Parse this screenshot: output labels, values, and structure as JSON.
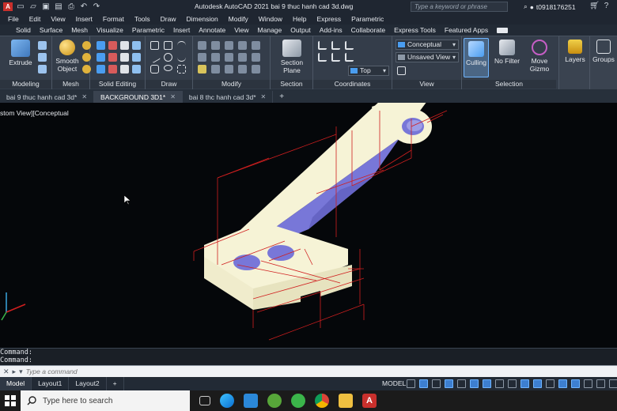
{
  "app": {
    "title": "Autodesk AutoCAD 2021    bai 9 thuc hanh cad 3d.dwg",
    "search_placeholder": "Type a keyword or phrase",
    "user": "t0918176251"
  },
  "menu": [
    "File",
    "Edit",
    "View",
    "Insert",
    "Format",
    "Tools",
    "Draw",
    "Dimension",
    "Modify",
    "Window",
    "Help",
    "Express",
    "Parametric"
  ],
  "ribbon_tabs": {
    "items": [
      "Solid",
      "Surface",
      "Mesh",
      "Visualize",
      "Parametric",
      "Insert",
      "Annotate",
      "View",
      "Manage",
      "Output",
      "Add-ins",
      "Collaborate",
      "Express Tools",
      "Featured Apps"
    ],
    "active": "Home"
  },
  "ribbon": {
    "extrude": "Extrude",
    "smooth_object": "Smooth Object",
    "section_plane": "Section Plane",
    "culling": "Culling",
    "no_filter": "No Filter",
    "move_gizmo": "Move Gizmo",
    "layers": "Layers",
    "groups": "Groups",
    "visual_style": "Conceptual",
    "saved_view": "Unsaved View",
    "ucs_view": "Top",
    "panels": {
      "modeling": "Modeling",
      "mesh": "Mesh",
      "solid_editing": "Solid Editing",
      "draw": "Draw",
      "modify": "Modify",
      "section": "Section",
      "coordinates": "Coordinates",
      "view": "View",
      "selection": "Selection"
    }
  },
  "file_tabs": [
    {
      "label": "bai 9 thuc hanh cad 3d*",
      "active": false
    },
    {
      "label": "BACKGROUND 3D1*",
      "active": true
    },
    {
      "label": "bai 8 thc hanh cad 3d*",
      "active": false
    }
  ],
  "viewport": {
    "label": "stom View][Conceptual"
  },
  "command": {
    "history": [
      "Command:",
      "Command:"
    ],
    "placeholder": "Type a command"
  },
  "layouts": [
    "Model",
    "Layout1",
    "Layout2"
  ],
  "status": {
    "model": "MODEL"
  },
  "taskbar": {
    "search_placeholder": "Type here to search"
  },
  "colors": {
    "accent": "#6fb5ff",
    "dimension_red": "#d01f1f",
    "solid_light": "#f6f3d6",
    "solid_shade": "#7877d8"
  }
}
